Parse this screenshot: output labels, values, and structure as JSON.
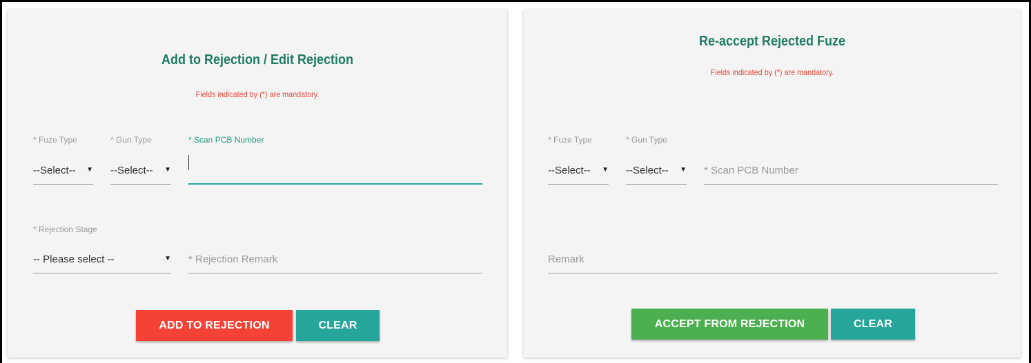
{
  "left_panel": {
    "title": "Add to Rejection / Edit Rejection",
    "mandatory_note": "Fields indicated by (*) are mandatory.",
    "fuze_type": {
      "label": "* Fuze Type",
      "value": "--Select--"
    },
    "gun_type": {
      "label": "* Gun Type",
      "value": "--Select--"
    },
    "scan_pcb": {
      "label": "* Scan PCB Number",
      "value": ""
    },
    "rejection_stage": {
      "label": "* Rejection Stage",
      "value": "-- Please select --"
    },
    "rejection_remark": {
      "placeholder": "* Rejection Remark",
      "value": ""
    },
    "add_button": "ADD TO REJECTION",
    "clear_button": "CLEAR"
  },
  "right_panel": {
    "title": "Re-accept Rejected Fuze",
    "mandatory_note": "Fields indicated by (*) are mandatory.",
    "fuze_type": {
      "label": "* Fuze Type",
      "value": "--Select--"
    },
    "gun_type": {
      "label": "* Gun Type",
      "value": "--Select--"
    },
    "scan_pcb": {
      "placeholder": "* Scan PCB Number",
      "value": ""
    },
    "remark": {
      "placeholder": "Remark",
      "value": ""
    },
    "accept_button": "ACCEPT FROM REJECTION",
    "clear_button": "CLEAR"
  },
  "colors": {
    "title": "#1e7a66",
    "mandatory": "#e8473b",
    "add_button": "#f44336",
    "clear_button": "#26a69a",
    "accept_button": "#4caf50",
    "focus_underline": "#26a69a"
  },
  "icons": {
    "dropdown": "caret-down-icon"
  }
}
